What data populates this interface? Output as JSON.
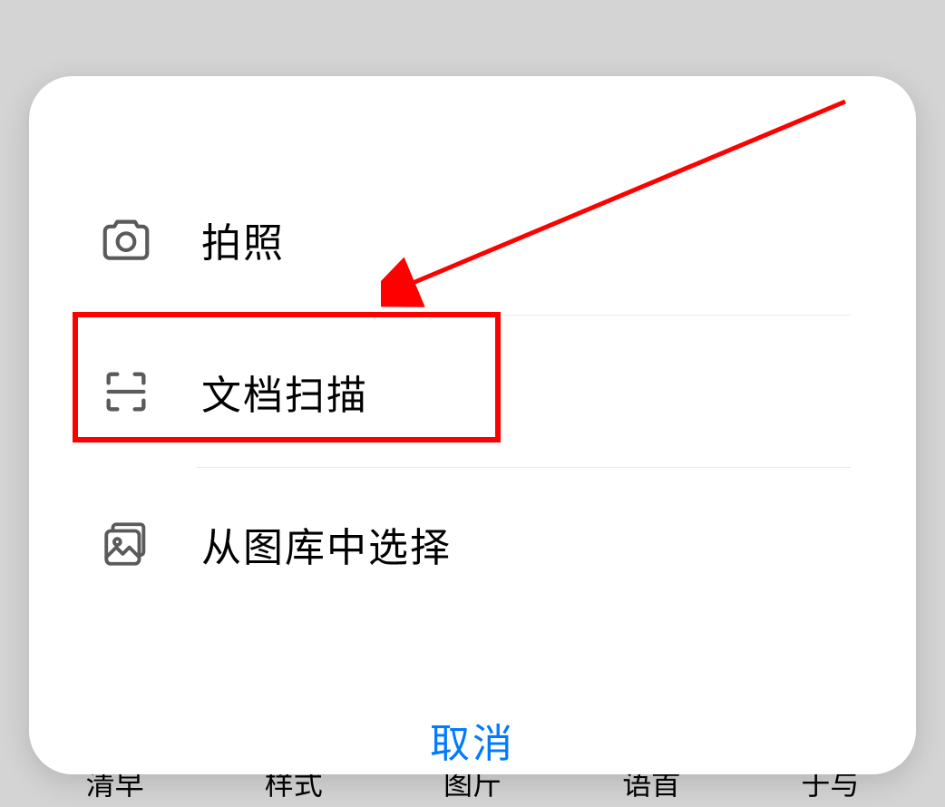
{
  "modal": {
    "options": [
      {
        "label": "拍照",
        "icon": "camera"
      },
      {
        "label": "文档扫描",
        "icon": "scan"
      },
      {
        "label": "从图库中选择",
        "icon": "gallery"
      }
    ],
    "cancel_label": "取消"
  },
  "tabs": [
    "清早",
    "样式",
    "图斤",
    "语首",
    "于与"
  ],
  "annotation": {
    "highlight_index": 1,
    "arrow_color": "#ff0000"
  }
}
